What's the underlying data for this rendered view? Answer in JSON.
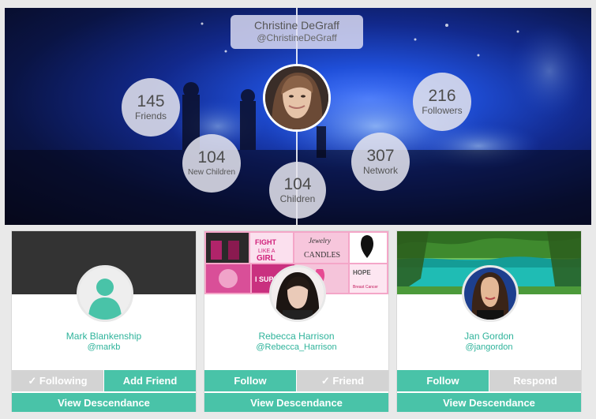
{
  "profile": {
    "full_name": "Christine DeGraff",
    "handle": "@ChristineDeGraff"
  },
  "stats": {
    "friends": {
      "value": "145",
      "label": "Friends"
    },
    "followers": {
      "value": "216",
      "label": "Followers"
    },
    "new_children": {
      "value": "104",
      "label": "New Children"
    },
    "network": {
      "value": "307",
      "label": "Network"
    },
    "children": {
      "value": "104",
      "label": "Children"
    }
  },
  "cards": [
    {
      "name": "Mark Blankenship",
      "handle": "@markb",
      "button_left": "✓ Following",
      "button_right": "Add Friend",
      "button_wide": "View Descendance"
    },
    {
      "name": "Rebecca Harrison",
      "handle": "@Rebecca_Harrison",
      "button_left": "Follow",
      "button_right": "✓ Friend",
      "button_wide": "View Descendance",
      "cover_texts": [
        "FIGHT",
        "LIKE A",
        "GIRL",
        "Jewelry",
        "CANDLES",
        "I SUPPORT",
        "HOPE",
        "Breast Cancer"
      ]
    },
    {
      "name": "Jan Gordon",
      "handle": "@jangordon",
      "button_left": "Follow",
      "button_right": "Respond",
      "button_wide": "View Descendance"
    }
  ],
  "colors": {
    "accent": "#49c3a8",
    "accent_text": "#2fb39b",
    "inactive_button": "#d3d3d3",
    "page_bg": "#e9e9e9"
  }
}
